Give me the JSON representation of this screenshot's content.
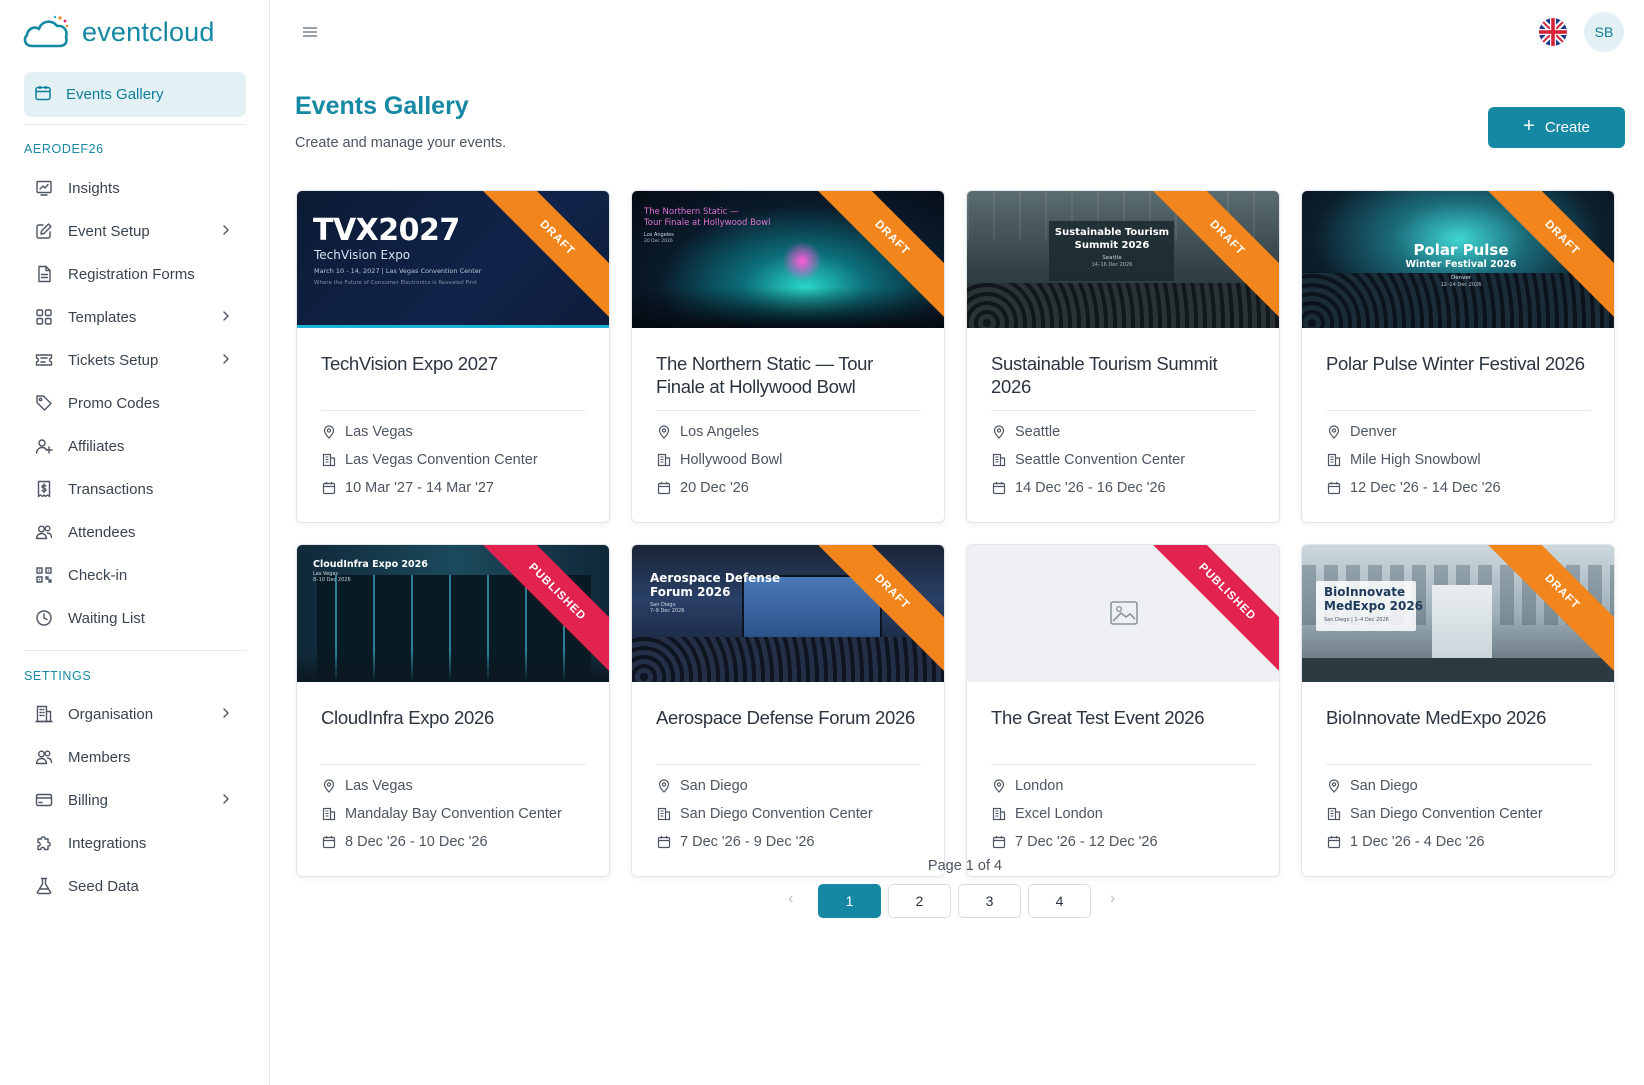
{
  "app": {
    "logo_text": "eventcloud",
    "user_initials": "SB",
    "language_flag": "uk-flag-icon"
  },
  "sidebar": {
    "active_item": "Events Gallery",
    "section_event": "AERODEF26",
    "event_items": [
      {
        "label": "Insights",
        "icon": "chart-icon",
        "has_submenu": false
      },
      {
        "label": "Event Setup",
        "icon": "edit-icon",
        "has_submenu": true
      },
      {
        "label": "Registration Forms",
        "icon": "form-icon",
        "has_submenu": false
      },
      {
        "label": "Templates",
        "icon": "grid-icon",
        "has_submenu": true
      },
      {
        "label": "Tickets Setup",
        "icon": "ticket-icon",
        "has_submenu": true
      },
      {
        "label": "Promo Codes",
        "icon": "tag-icon",
        "has_submenu": false
      },
      {
        "label": "Affiliates",
        "icon": "user-plus-icon",
        "has_submenu": false
      },
      {
        "label": "Transactions",
        "icon": "receipt-icon",
        "has_submenu": false
      },
      {
        "label": "Attendees",
        "icon": "users-icon",
        "has_submenu": false
      },
      {
        "label": "Check-in",
        "icon": "qr-icon",
        "has_submenu": false
      },
      {
        "label": "Waiting List",
        "icon": "clock-icon",
        "has_submenu": false
      }
    ],
    "section_settings": "SETTINGS",
    "settings_items": [
      {
        "label": "Organisation",
        "icon": "building-icon",
        "has_submenu": true
      },
      {
        "label": "Members",
        "icon": "users-icon",
        "has_submenu": false
      },
      {
        "label": "Billing",
        "icon": "card-icon",
        "has_submenu": true
      },
      {
        "label": "Integrations",
        "icon": "puzzle-icon",
        "has_submenu": false
      },
      {
        "label": "Seed Data",
        "icon": "flask-icon",
        "has_submenu": false
      }
    ]
  },
  "header": {
    "title": "Events Gallery",
    "subtitle": "Create and manage your events.",
    "create_label": "Create"
  },
  "events": [
    {
      "title": "TechVision Expo 2027",
      "city": "Las Vegas",
      "venue": "Las Vegas Convention Center",
      "dates": "10 Mar '27 - 14 Mar '27",
      "status": "DRAFT",
      "image_text": {
        "title": "TVX2027",
        "sub": "TechVision Expo",
        "detail": "March 10 - 14, 2027  |  Las Vegas Convention Center",
        "tagline": "Where the Future of Consumer Electronics is Revealed First"
      }
    },
    {
      "title": "The Northern Static — Tour Finale at Hollywood Bowl",
      "city": "Los Angeles",
      "venue": "Hollywood Bowl",
      "dates": "20 Dec '26",
      "status": "DRAFT",
      "image_text": {
        "title": "The Northern Static —",
        "sub": "Tour Finale at Hollywood Bowl",
        "detail": "Los Angeles",
        "tagline": "20 Dec 2026"
      }
    },
    {
      "title": "Sustainable Tourism Summit 2026",
      "city": "Seattle",
      "venue": "Seattle Convention Center",
      "dates": "14 Dec '26 - 16 Dec '26",
      "status": "DRAFT",
      "image_text": {
        "title": "Sustainable Tourism",
        "sub": "Summit 2026",
        "detail": "Seattle",
        "tagline": "14–16 Dec 2026"
      }
    },
    {
      "title": "Polar Pulse Winter Festival 2026",
      "city": "Denver",
      "venue": "Mile High Snowbowl",
      "dates": "12 Dec '26 - 14 Dec '26",
      "status": "DRAFT",
      "image_text": {
        "title": "Polar Pulse",
        "sub": "Winter Festival 2026",
        "detail": "Denver",
        "tagline": "12–14 Dec 2026"
      }
    },
    {
      "title": "CloudInfra Expo 2026",
      "city": "Las Vegas",
      "venue": "Mandalay Bay Convention Center",
      "dates": "8 Dec '26 - 10 Dec '26",
      "status": "PUBLISHED",
      "image_text": {
        "title": "CloudInfra Expo 2026",
        "sub": "Las Vegas",
        "detail": "8–10 Dec 2026",
        "tagline": ""
      }
    },
    {
      "title": "Aerospace Defense Forum 2026",
      "city": "San Diego",
      "venue": "San Diego Convention Center",
      "dates": "7 Dec '26 - 9 Dec '26",
      "status": "DRAFT",
      "image_text": {
        "title": "Aerospace Defense",
        "sub": "Forum 2026",
        "detail": "San Diego",
        "tagline": "7–9 Dec 2026"
      }
    },
    {
      "title": "The Great Test Event 2026",
      "city": "London",
      "venue": "Excel London",
      "dates": "7 Dec '26 - 12 Dec '26",
      "status": "PUBLISHED",
      "image_text": {
        "title": "",
        "sub": "",
        "detail": "",
        "tagline": ""
      }
    },
    {
      "title": "BioInnovate MedExpo 2026",
      "city": "San Diego",
      "venue": "San Diego Convention Center",
      "dates": "1 Dec '26 - 4 Dec '26",
      "status": "DRAFT",
      "image_text": {
        "title": "BioInnovate",
        "sub": "MedExpo 2026",
        "detail": "San Diego  |  1–4 Dec 2026",
        "tagline": ""
      }
    }
  ],
  "pagination": {
    "label": "Page 1 of 4",
    "pages": [
      "1",
      "2",
      "3",
      "4"
    ],
    "current": "1"
  },
  "colors": {
    "accent": "#1588a3",
    "draft": "#f2851c",
    "published": "#e3234f"
  }
}
